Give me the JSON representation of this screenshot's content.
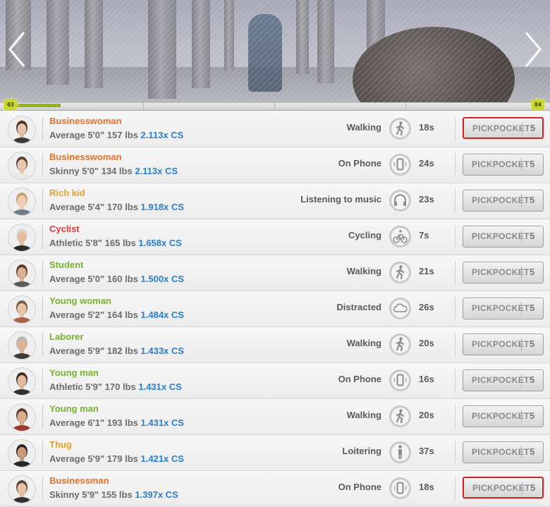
{
  "timeline": {
    "start_badge": "03",
    "end_badge": "04",
    "progress": 0.085
  },
  "colors": {
    "cs_value": "#2a7fd0",
    "highlight_border": "#d51e1e",
    "timeline_fill": "#9fbf1e"
  },
  "people": [
    {
      "name": "Businesswoman",
      "name_color": "#e8712b",
      "build": "Average",
      "height": "5'0\"",
      "weight": "157 lbs",
      "cs": "2.113x CS",
      "activity": "Walking",
      "activity_icon": "walking-icon",
      "time": "18s",
      "action": "PICKPOCKET",
      "cost": "5",
      "highlighted": true
    },
    {
      "name": "Businesswoman",
      "name_color": "#e8712b",
      "build": "Skinny",
      "height": "5'0\"",
      "weight": "134 lbs",
      "cs": "2.113x CS",
      "activity": "On Phone",
      "activity_icon": "phone-icon",
      "time": "24s",
      "action": "PICKPOCKET",
      "cost": "5",
      "highlighted": false
    },
    {
      "name": "Rich kid",
      "name_color": "#e8a126",
      "build": "Average",
      "height": "5'4\"",
      "weight": "170 lbs",
      "cs": "1.918x CS",
      "activity": "Listening to music",
      "activity_icon": "headphones-icon",
      "time": "23s",
      "action": "PICKPOCKET",
      "cost": "5",
      "highlighted": false
    },
    {
      "name": "Cyclist",
      "name_color": "#e23a3a",
      "build": "Athletic",
      "height": "5'8\"",
      "weight": "165 lbs",
      "cs": "1.658x CS",
      "activity": "Cycling",
      "activity_icon": "bicycle-icon",
      "time": "7s",
      "action": "PICKPOCKET",
      "cost": "5",
      "highlighted": false
    },
    {
      "name": "Student",
      "name_color": "#79b22e",
      "build": "Average",
      "height": "5'0\"",
      "weight": "160 lbs",
      "cs": "1.500x CS",
      "activity": "Walking",
      "activity_icon": "walking-icon",
      "time": "21s",
      "action": "PICKPOCKET",
      "cost": "5",
      "highlighted": false
    },
    {
      "name": "Young woman",
      "name_color": "#79b22e",
      "build": "Average",
      "height": "5'2\"",
      "weight": "164 lbs",
      "cs": "1.484x CS",
      "activity": "Distracted",
      "activity_icon": "cloud-icon",
      "time": "26s",
      "action": "PICKPOCKET",
      "cost": "5",
      "highlighted": false
    },
    {
      "name": "Laborer",
      "name_color": "#79b22e",
      "build": "Average",
      "height": "5'9\"",
      "weight": "182 lbs",
      "cs": "1.433x CS",
      "activity": "Walking",
      "activity_icon": "walking-icon",
      "time": "20s",
      "action": "PICKPOCKET",
      "cost": "5",
      "highlighted": false
    },
    {
      "name": "Young man",
      "name_color": "#79b22e",
      "build": "Athletic",
      "height": "5'9\"",
      "weight": "170 lbs",
      "cs": "1.431x CS",
      "activity": "On Phone",
      "activity_icon": "phone-icon",
      "time": "16s",
      "action": "PICKPOCKET",
      "cost": "5",
      "highlighted": false
    },
    {
      "name": "Young man",
      "name_color": "#79b22e",
      "build": "Average",
      "height": "6'1\"",
      "weight": "193 lbs",
      "cs": "1.431x CS",
      "activity": "Walking",
      "activity_icon": "walking-icon",
      "time": "20s",
      "action": "PICKPOCKET",
      "cost": "5",
      "highlighted": false
    },
    {
      "name": "Thug",
      "name_color": "#e8a126",
      "build": "Average",
      "height": "5'9\"",
      "weight": "179 lbs",
      "cs": "1.421x CS",
      "activity": "Loitering",
      "activity_icon": "standing-icon",
      "time": "37s",
      "action": "PICKPOCKET",
      "cost": "5",
      "highlighted": false
    },
    {
      "name": "Businessman",
      "name_color": "#e8712b",
      "build": "Skinny",
      "height": "5'9\"",
      "weight": "155 lbs",
      "cs": "1.397x CS",
      "activity": "On Phone",
      "activity_icon": "phone-icon",
      "time": "18s",
      "action": "PICKPOCKET",
      "cost": "5",
      "highlighted": true
    }
  ]
}
